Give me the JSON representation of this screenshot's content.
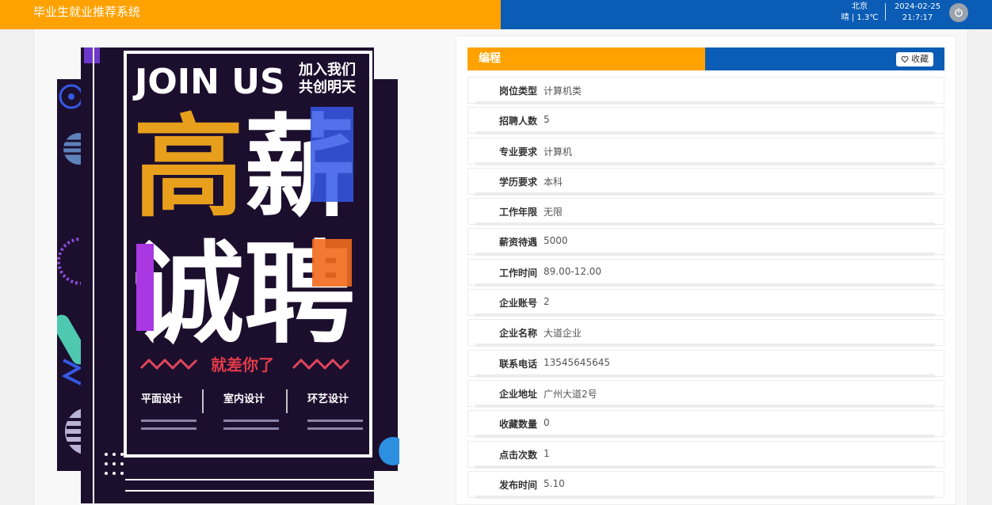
{
  "header": {
    "app_title": "毕业生就业推荐系统",
    "weather_city": "北京",
    "weather_info": "晴 | 1.3℃",
    "date": "2024-02-25",
    "time": "21:7:17",
    "power_icon": "power-icon"
  },
  "poster": {
    "join_us": "JOIN US",
    "slogan_line1": "加入我们",
    "slogan_line2": "共创明天",
    "big_text_1a": "高",
    "big_text_1b": "薪",
    "big_text_2a": "诚",
    "big_text_2b": "聘",
    "tagline": "就差你了",
    "job_1": "平面设计",
    "job_2": "室内设计",
    "job_3": "环艺设计",
    "colors": {
      "bg": "#1c0f2e",
      "orange": "#e8a01c",
      "blue": "#3558e6",
      "purple": "#a938e3",
      "accent": "#f26a1d"
    }
  },
  "detail": {
    "title": "编程",
    "favorite_label": "收藏",
    "favorite_icon": "heart-icon",
    "fields": [
      {
        "label": "岗位类型",
        "value": "计算机类"
      },
      {
        "label": "招聘人数",
        "value": "5"
      },
      {
        "label": "专业要求",
        "value": "计算机"
      },
      {
        "label": "学历要求",
        "value": "本科"
      },
      {
        "label": "工作年限",
        "value": "无限"
      },
      {
        "label": "薪资待遇",
        "value": "5000"
      },
      {
        "label": "工作时间",
        "value": "89.00-12.00"
      },
      {
        "label": "企业账号",
        "value": "2"
      },
      {
        "label": "企业名称",
        "value": "大道企业"
      },
      {
        "label": "联系电话",
        "value": "13545645645"
      },
      {
        "label": "企业地址",
        "value": "广州大道2号"
      },
      {
        "label": "收藏数量",
        "value": "0"
      },
      {
        "label": "点击次数",
        "value": "1"
      },
      {
        "label": "发布时间",
        "value": "5.10"
      }
    ]
  },
  "colors": {
    "orange": "#ffa200",
    "blue": "#0a5cb5"
  }
}
